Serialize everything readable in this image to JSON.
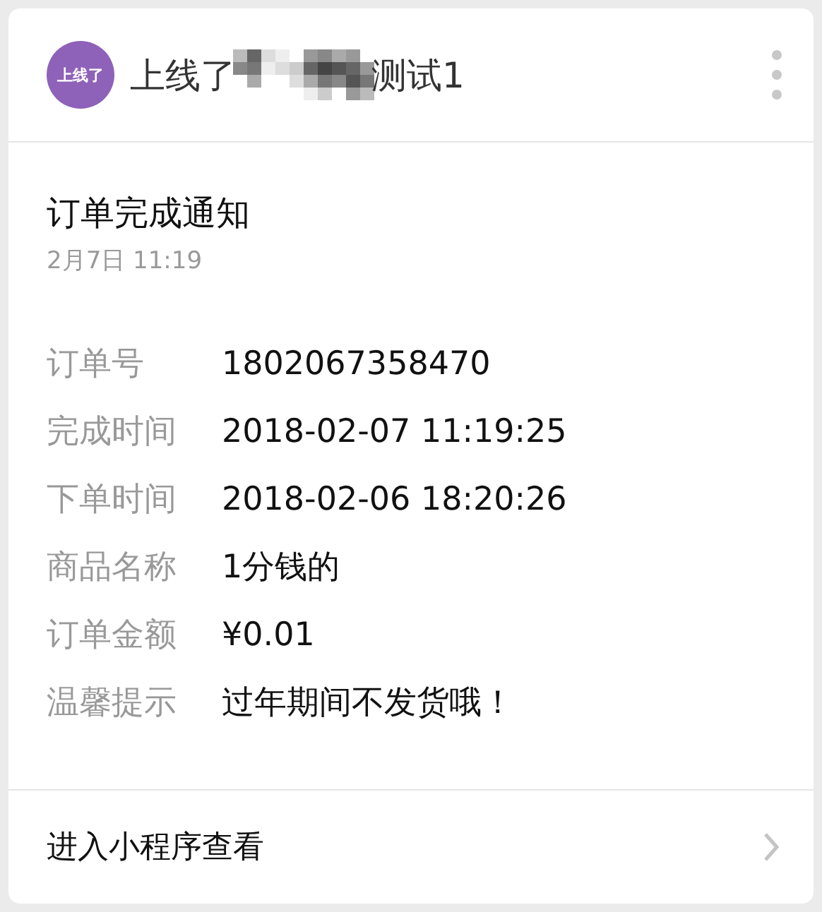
{
  "header": {
    "logo_text": "上线了",
    "title_start": "上线了",
    "title_end": "测试1"
  },
  "message": {
    "title": "订单完成通知",
    "date": "2月7日  11:19",
    "fields": [
      {
        "label": "订单号",
        "value": "1802067358470"
      },
      {
        "label": "完成时间",
        "value": "2018-02-07 11:19:25"
      },
      {
        "label": "下单时间",
        "value": "2018-02-06 18:20:26"
      },
      {
        "label": "商品名称",
        "value": "1分钱的"
      },
      {
        "label": "订单金额",
        "value": "¥0.01"
      },
      {
        "label": "温馨提示",
        "value": "过年期间不发货哦！"
      }
    ]
  },
  "footer": {
    "link": "进入小程序查看"
  }
}
